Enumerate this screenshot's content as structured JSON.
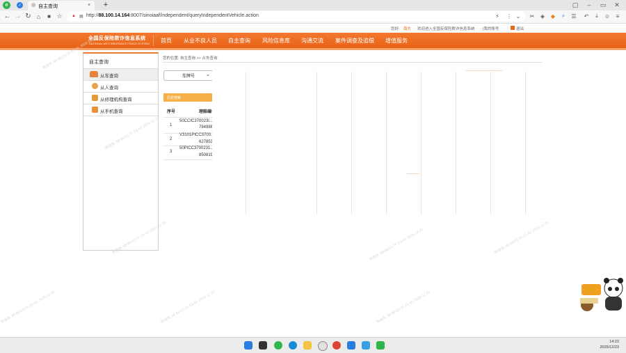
{
  "browser": {
    "tab_title": "自主查询",
    "url_host": "88.100.14.164",
    "url_path": ":8007/sinoiaaf/independent/queryIndependentVehicle.action",
    "url_prefix": "http://"
  },
  "site": {
    "top_info": {
      "greeting": "您好:",
      "user_name": "南方",
      "welcome": "欢迎进入全国反保险欺诈信息系统",
      "my_account": "|我的账号",
      "logout": "退出"
    },
    "logo_cn": "全国反保险欺诈信息系统",
    "logo_en": "NATIONAL ANTI INSURANCE FRAUD SYSTEM",
    "nav": [
      "首页",
      "从业不良人员",
      "自主查询",
      "风险信息库",
      "沟通交流",
      "案件调查及追偿",
      "增值服务"
    ]
  },
  "sidebar": {
    "title": "自主查询",
    "items": [
      {
        "label": "从车查询",
        "active": true
      },
      {
        "label": "从人查询",
        "active": false
      },
      {
        "label": "从修理机构查询",
        "active": false
      },
      {
        "label": "从手机查询",
        "active": false
      }
    ]
  },
  "breadcrumb": "您的位置: 自主查询 >> 从车查询",
  "query": {
    "select_value": "车牌号"
  },
  "history": {
    "title": "历史搜索",
    "columns": [
      "序号",
      "理赔编号"
    ],
    "rows": [
      {
        "no": "1",
        "id_line1": "50CCIC370023l...",
        "id_line2": "784986"
      },
      {
        "no": "2",
        "id_line1": "V3101PICC3700...",
        "id_line2": "627853"
      },
      {
        "no": "3",
        "id_line1": "50PICC3700231...",
        "id_line2": "850819"
      }
    ]
  },
  "watermark": "陈佳禾, 88-88-03-7F-23-40, 2025-12-23",
  "taskbar": {
    "time": "14:22",
    "date": "2025/12/23"
  },
  "colors": {
    "brand_orange": "#e86216",
    "accent_yellow": "#f5b04a"
  }
}
